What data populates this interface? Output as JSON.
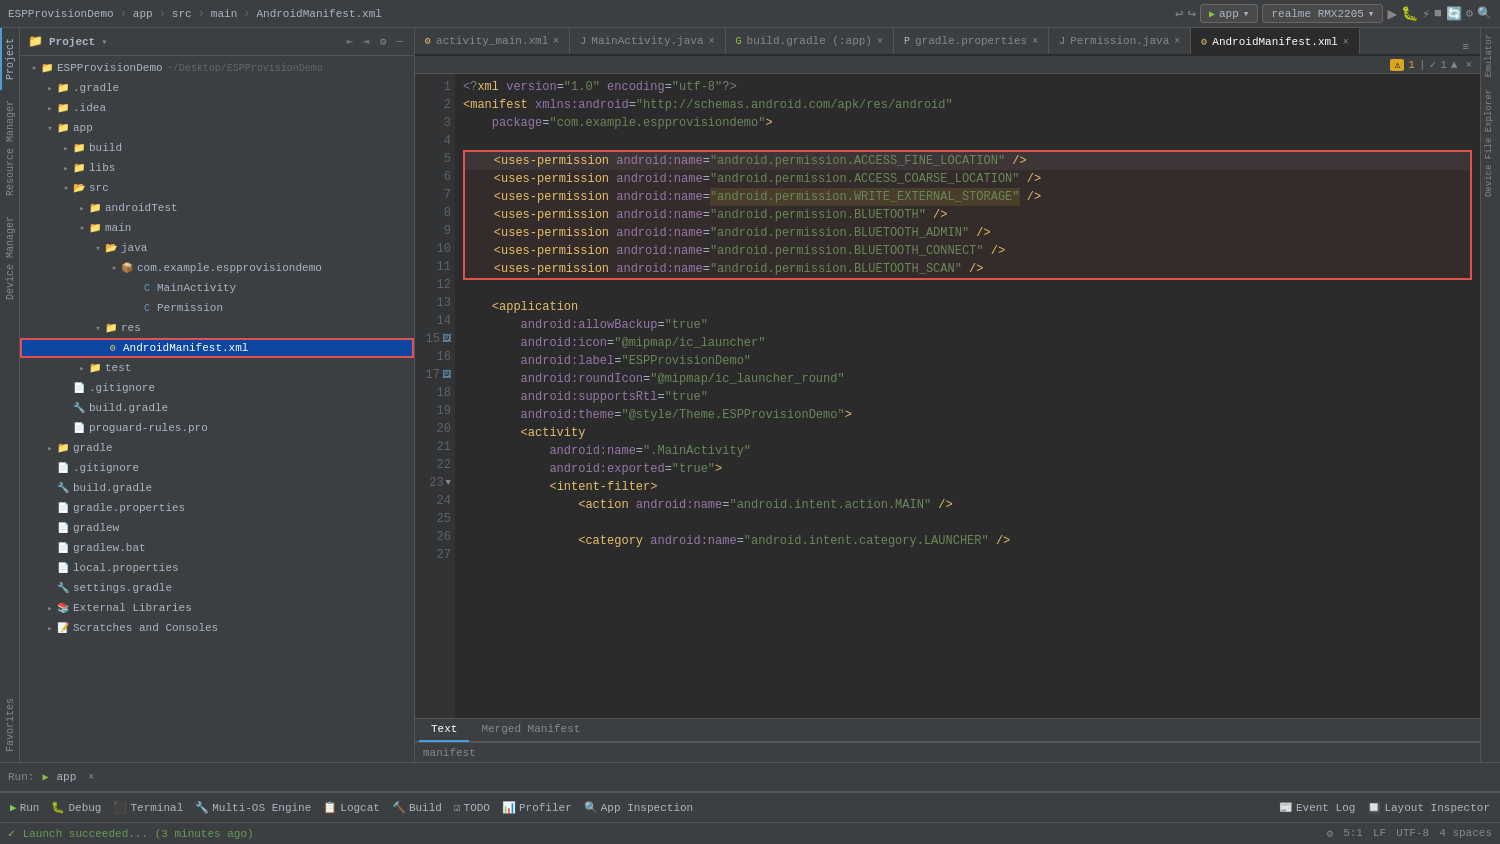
{
  "topbar": {
    "project": "ESPProvisionDemo",
    "separator1": "›",
    "app": "app",
    "separator2": "›",
    "src": "src",
    "separator3": "›",
    "main": "main",
    "separator4": "›",
    "file": "AndroidManifest.xml",
    "run_config": "app",
    "device": "realme RMX2205",
    "icons": [
      "↩",
      "↪",
      "⚙",
      "▶",
      "■"
    ]
  },
  "panel": {
    "title": "Project",
    "root": "ESPProvisionDemo",
    "root_path": "~/Desktop/ESPProvisionDemo",
    "items": [
      {
        "id": "gradle",
        "label": ".gradle",
        "type": "folder",
        "depth": 1,
        "expanded": false
      },
      {
        "id": "idea",
        "label": ".idea",
        "type": "folder",
        "depth": 1,
        "expanded": false
      },
      {
        "id": "app",
        "label": "app",
        "type": "folder",
        "depth": 1,
        "expanded": true
      },
      {
        "id": "build_app",
        "label": "build",
        "type": "folder",
        "depth": 2,
        "expanded": false
      },
      {
        "id": "libs",
        "label": "libs",
        "type": "folder",
        "depth": 2,
        "expanded": false
      },
      {
        "id": "src",
        "label": "src",
        "type": "folder",
        "depth": 2,
        "expanded": true
      },
      {
        "id": "androidTest",
        "label": "androidTest",
        "type": "folder",
        "depth": 3,
        "expanded": false
      },
      {
        "id": "main",
        "label": "main",
        "type": "folder",
        "depth": 3,
        "expanded": true
      },
      {
        "id": "java",
        "label": "java",
        "type": "folder",
        "depth": 4,
        "expanded": true
      },
      {
        "id": "com_example",
        "label": "com.example.espprovisiondemo",
        "type": "folder",
        "depth": 5,
        "expanded": true
      },
      {
        "id": "mainactivity",
        "label": "MainActivity",
        "type": "class",
        "depth": 6
      },
      {
        "id": "permission",
        "label": "Permission",
        "type": "class",
        "depth": 6
      },
      {
        "id": "res",
        "label": "res",
        "type": "folder",
        "depth": 4,
        "expanded": true
      },
      {
        "id": "androidmanifest",
        "label": "AndroidManifest.xml",
        "type": "xml",
        "depth": 4,
        "selected": true
      },
      {
        "id": "test",
        "label": "test",
        "type": "folder",
        "depth": 3,
        "expanded": false
      },
      {
        "id": "gitignore_app",
        "label": ".gitignore",
        "type": "file",
        "depth": 2
      },
      {
        "id": "build_gradle_app",
        "label": "build.gradle",
        "type": "gradle",
        "depth": 2
      },
      {
        "id": "proguard",
        "label": "proguard-rules.pro",
        "type": "file",
        "depth": 2
      },
      {
        "id": "gradle_folder",
        "label": "gradle",
        "type": "folder",
        "depth": 1,
        "expanded": false
      },
      {
        "id": "gitignore_root",
        "label": ".gitignore",
        "type": "file",
        "depth": 1
      },
      {
        "id": "build_gradle_root",
        "label": "build.gradle",
        "type": "gradle",
        "depth": 1
      },
      {
        "id": "gradle_properties",
        "label": "gradle.properties",
        "type": "file",
        "depth": 1
      },
      {
        "id": "gradlew",
        "label": "gradlew",
        "type": "file",
        "depth": 1
      },
      {
        "id": "gradlew_bat",
        "label": "gradlew.bat",
        "type": "file",
        "depth": 1
      },
      {
        "id": "local_properties",
        "label": "local.properties",
        "type": "file",
        "depth": 1
      },
      {
        "id": "settings_gradle",
        "label": "settings.gradle",
        "type": "gradle",
        "depth": 1
      },
      {
        "id": "external_libs",
        "label": "External Libraries",
        "type": "folder",
        "depth": 1,
        "expanded": false
      },
      {
        "id": "scratches",
        "label": "Scratches and Consoles",
        "type": "folder",
        "depth": 1,
        "expanded": false
      }
    ]
  },
  "tabs": [
    {
      "id": "activity_main",
      "label": "activity_main.xml",
      "active": false
    },
    {
      "id": "mainactivity_java",
      "label": "MainActivity.java",
      "active": false
    },
    {
      "id": "build_gradle_tab",
      "label": "build.gradle (:app)",
      "active": false
    },
    {
      "id": "gradle_properties_tab",
      "label": "gradle.properties",
      "active": false
    },
    {
      "id": "permission_java",
      "label": "Permission.java",
      "active": false
    },
    {
      "id": "androidmanifest_tab",
      "label": "AndroidManifest.xml",
      "active": true
    }
  ],
  "warning": {
    "icon": "⚠",
    "count": "1",
    "check_count": "1"
  },
  "code": {
    "lines": [
      {
        "num": 1,
        "content": "<?xml version=\"1.0\" encoding=\"utf-8\"?>"
      },
      {
        "num": 2,
        "content": "<manifest xmlns:android=\"http://schemas.android.com/apk/res/android\""
      },
      {
        "num": 3,
        "content": "    package=\"com.example.espprovisiondemo\">"
      },
      {
        "num": 4,
        "content": ""
      },
      {
        "num": 5,
        "content": "    <uses-permission android:name=\"android.permission.ACCESS_FINE_LOCATION\" />",
        "highlight_box_start": true
      },
      {
        "num": 6,
        "content": "    <uses-permission android:name=\"android.permission.ACCESS_COARSE_LOCATION\" />"
      },
      {
        "num": 7,
        "content": "    <uses-permission android:name=\"android.permission.WRITE_EXTERNAL_STORAGE\" />",
        "highlight_write": true
      },
      {
        "num": 8,
        "content": "    <uses-permission android:name=\"android.permission.BLUETOOTH\" />"
      },
      {
        "num": 9,
        "content": "    <uses-permission android:name=\"android.permission.BLUETOOTH_ADMIN\" />"
      },
      {
        "num": 10,
        "content": "    <uses-permission android:name=\"android.permission.BLUETOOTH_CONNECT\" />"
      },
      {
        "num": 11,
        "content": "    <uses-permission android:name=\"android.permission.BLUETOOTH_SCAN\" />",
        "highlight_box_end": true
      },
      {
        "num": 12,
        "content": ""
      },
      {
        "num": 13,
        "content": "    <application"
      },
      {
        "num": 14,
        "content": "        android:allowBackup=\"true\""
      },
      {
        "num": 15,
        "content": "        android:icon=\"@mipmap/ic_launcher\""
      },
      {
        "num": 16,
        "content": "        android:label=\"ESPProvisionDemo\""
      },
      {
        "num": 17,
        "content": "        android:roundIcon=\"@mipmap/ic_launcher_round\""
      },
      {
        "num": 18,
        "content": "        android:supportsRtl=\"true\""
      },
      {
        "num": 19,
        "content": "        android:theme=\"@style/Theme.ESPProvisionDemo\">"
      },
      {
        "num": 20,
        "content": "        <activity"
      },
      {
        "num": 21,
        "content": "            android:name=\".MainActivity\""
      },
      {
        "num": 22,
        "content": "            android:exported=\"true\">"
      },
      {
        "num": 23,
        "content": "            <intent-filter>"
      },
      {
        "num": 24,
        "content": "                <action android:name=\"android.intent.action.MAIN\" />"
      },
      {
        "num": 25,
        "content": ""
      },
      {
        "num": 26,
        "content": "                <category android:name=\"android.intent.category.LAUNCHER\" />"
      },
      {
        "num": 27,
        "content": ""
      }
    ]
  },
  "bottom_tabs": {
    "text": "Text",
    "merged": "Merged Manifest"
  },
  "breadcrumb": "manifest",
  "run_bar": {
    "label": "Run:",
    "app": "app",
    "close": "×"
  },
  "bottom_tools": [
    {
      "id": "run",
      "label": "▶ Run",
      "icon": "run"
    },
    {
      "id": "debug",
      "label": "🐛 Debug",
      "icon": "debug"
    },
    {
      "id": "terminal",
      "label": "⬛ Terminal",
      "icon": "terminal"
    },
    {
      "id": "multios",
      "label": "🔧 Multi-OS Engine",
      "icon": "multios"
    },
    {
      "id": "logcat",
      "label": "📋 Logcat",
      "icon": "logcat"
    },
    {
      "id": "build",
      "label": "🔨 Build",
      "icon": "build"
    },
    {
      "id": "todo",
      "label": "☑ TODO",
      "icon": "todo"
    },
    {
      "id": "profiler",
      "label": "📊 Profiler",
      "icon": "profiler"
    },
    {
      "id": "app_inspection",
      "label": "🔍 App Inspection",
      "icon": "inspection"
    }
  ],
  "status_bar": {
    "launch_msg": "Launch succeeded... (3 minutes ago)",
    "settings_icon": "⚙",
    "right": {
      "line_col": "5:1",
      "lf": "LF",
      "encoding": "UTF-8",
      "indent": "4 spaces"
    }
  },
  "right_tools": {
    "event_log": "Event Log",
    "layout_inspector": "Layout Inspector"
  },
  "left_panels": {
    "project": "Project",
    "resource_manager": "Resource Manager",
    "device_manager": "Device Manager",
    "favorites": "Favorites"
  }
}
